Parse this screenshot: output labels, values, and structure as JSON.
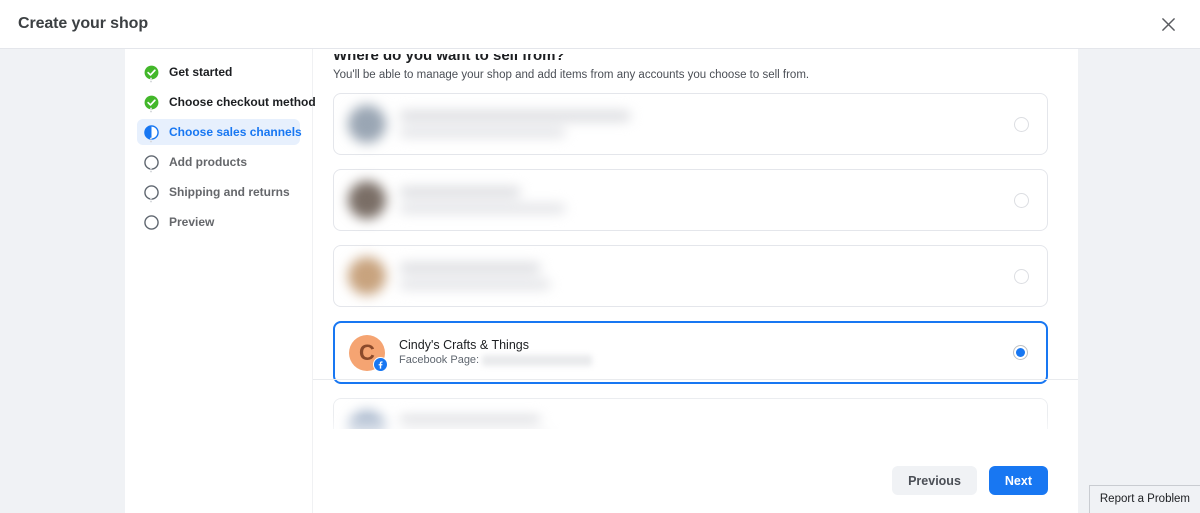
{
  "window": {
    "title": "Create your shop",
    "close_icon": "close-icon"
  },
  "sidebar": {
    "steps": [
      {
        "label": "Get started",
        "state": "done",
        "icon": "check-circle-icon"
      },
      {
        "label": "Choose checkout method",
        "state": "done",
        "icon": "check-circle-icon"
      },
      {
        "label": "Choose sales channels",
        "state": "active",
        "icon": "half-circle-icon"
      },
      {
        "label": "Add products",
        "state": "todo",
        "icon": "empty-circle-icon"
      },
      {
        "label": "Shipping and returns",
        "state": "todo",
        "icon": "empty-circle-icon"
      },
      {
        "label": "Preview",
        "state": "todo",
        "icon": "empty-circle-icon"
      }
    ]
  },
  "main": {
    "title": "Where do you want to sell from?",
    "subtitle": "You'll be able to manage your shop and add items from any accounts you choose to sell from.",
    "accounts": [
      {
        "name": "",
        "meta_label": "",
        "redacted": true,
        "selected": false,
        "blurred": true,
        "avatar_color": "#9aa6b4",
        "avatar_letter": ""
      },
      {
        "name": "",
        "meta_label": "",
        "redacted": true,
        "selected": false,
        "blurred": true,
        "avatar_color": "#7a6e66",
        "avatar_letter": ""
      },
      {
        "name": "",
        "meta_label": "",
        "redacted": true,
        "selected": false,
        "blurred": true,
        "avatar_color": "#c8a37e",
        "avatar_letter": ""
      },
      {
        "name": "Cindy's Crafts & Things",
        "meta_label": "Facebook Page:",
        "redacted": true,
        "selected": true,
        "blurred": false,
        "avatar_color": "#f5a472",
        "avatar_letter": "C",
        "badge_icon": "facebook-badge-icon"
      },
      {
        "name": "",
        "meta_label": "",
        "redacted": true,
        "selected": false,
        "blurred": true,
        "avatar_color": "#aebcd0",
        "avatar_letter": ""
      }
    ]
  },
  "footer": {
    "previous_label": "Previous",
    "next_label": "Next"
  },
  "report": {
    "label": "Report a Problem"
  },
  "colors": {
    "accent": "#1877f2",
    "done": "#42b72a",
    "page_bg": "#f0f2f5",
    "panel_bg": "#ffffff"
  }
}
